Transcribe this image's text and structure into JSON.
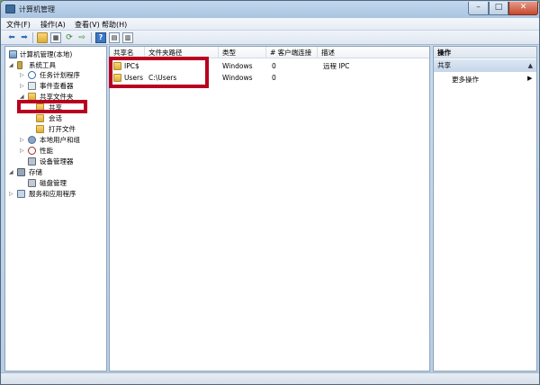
{
  "window": {
    "title": "计算机管理"
  },
  "menu": [
    "文件(F)",
    "操作(A)",
    "查看(V)",
    "帮助(H)"
  ],
  "tree": {
    "root": "计算机管理(本地)",
    "system_tools": "系统工具",
    "task_scheduler": "任务计划程序",
    "event_viewer": "事件查看器",
    "shared_folders": "共享文件夹",
    "shares": "共享",
    "sessions": "会话",
    "open_files": "打开文件",
    "local_users": "本地用户和组",
    "performance": "性能",
    "device_manager": "设备管理器",
    "storage": "存储",
    "disk_management": "磁盘管理",
    "services_apps": "服务和应用程序"
  },
  "table": {
    "columns": [
      "共享名",
      "文件夹路径",
      "类型",
      "# 客户端连接",
      "描述"
    ],
    "rows": [
      {
        "name": "IPC$",
        "path": "",
        "type": "Windows",
        "clients": "0",
        "desc": "远程 IPC"
      },
      {
        "name": "Users",
        "path": "C:\\Users",
        "type": "Windows",
        "clients": "0",
        "desc": ""
      }
    ]
  },
  "actions": {
    "header": "操作",
    "section": "共享",
    "more": "更多操作"
  },
  "colors": {
    "highlight": "#b8001f"
  },
  "icons": [
    "back-arrow-icon",
    "forward-arrow-icon",
    "folder-icon",
    "refresh-icon",
    "export-icon",
    "help-icon"
  ]
}
